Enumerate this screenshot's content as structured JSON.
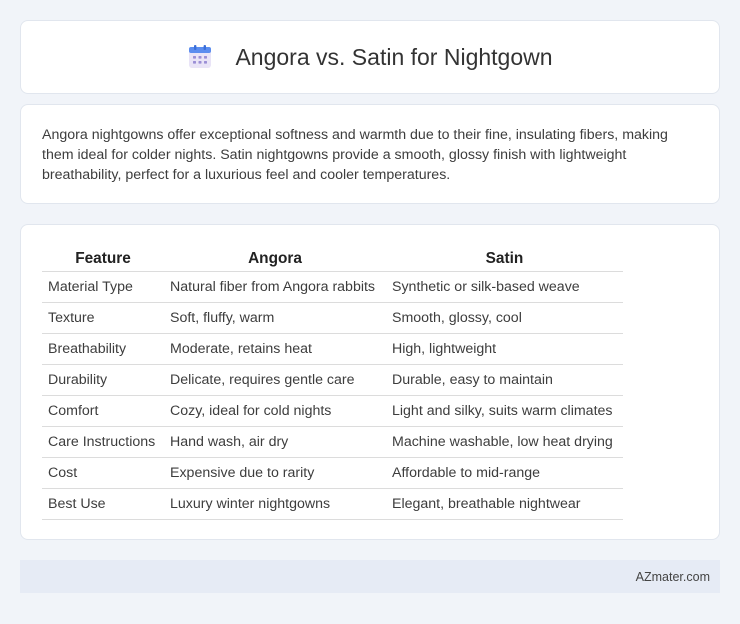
{
  "header": {
    "title": "Angora vs. Satin for Nightgown",
    "icon": "calendar-icon"
  },
  "intro": {
    "text": "Angora nightgowns offer exceptional softness and warmth due to their fine, insulating fibers, making them ideal for colder nights. Satin nightgowns provide a smooth, glossy finish with lightweight breathability, perfect for a luxurious feel and cooler temperatures."
  },
  "table": {
    "headers": [
      "Feature",
      "Angora",
      "Satin"
    ],
    "rows": [
      [
        "Material Type",
        "Natural fiber from Angora rabbits",
        "Synthetic or silk-based weave"
      ],
      [
        "Texture",
        "Soft, fluffy, warm",
        "Smooth, glossy, cool"
      ],
      [
        "Breathability",
        "Moderate, retains heat",
        "High, lightweight"
      ],
      [
        "Durability",
        "Delicate, requires gentle care",
        "Durable, easy to maintain"
      ],
      [
        "Comfort",
        "Cozy, ideal for cold nights",
        "Light and silky, suits warm climates"
      ],
      [
        "Care Instructions",
        "Hand wash, air dry",
        "Machine washable, low heat drying"
      ],
      [
        "Cost",
        "Expensive due to rarity",
        "Affordable to mid-range"
      ],
      [
        "Best Use",
        "Luxury winter nightgowns",
        "Elegant, breathable nightwear"
      ]
    ]
  },
  "footer": {
    "text": "AZmater.com"
  },
  "colors": {
    "background": "#f1f4f9",
    "card": "#ffffff",
    "footer": "#e6ebf5",
    "icon_top": "#5b8def",
    "icon_body": "#e9e4f7"
  }
}
